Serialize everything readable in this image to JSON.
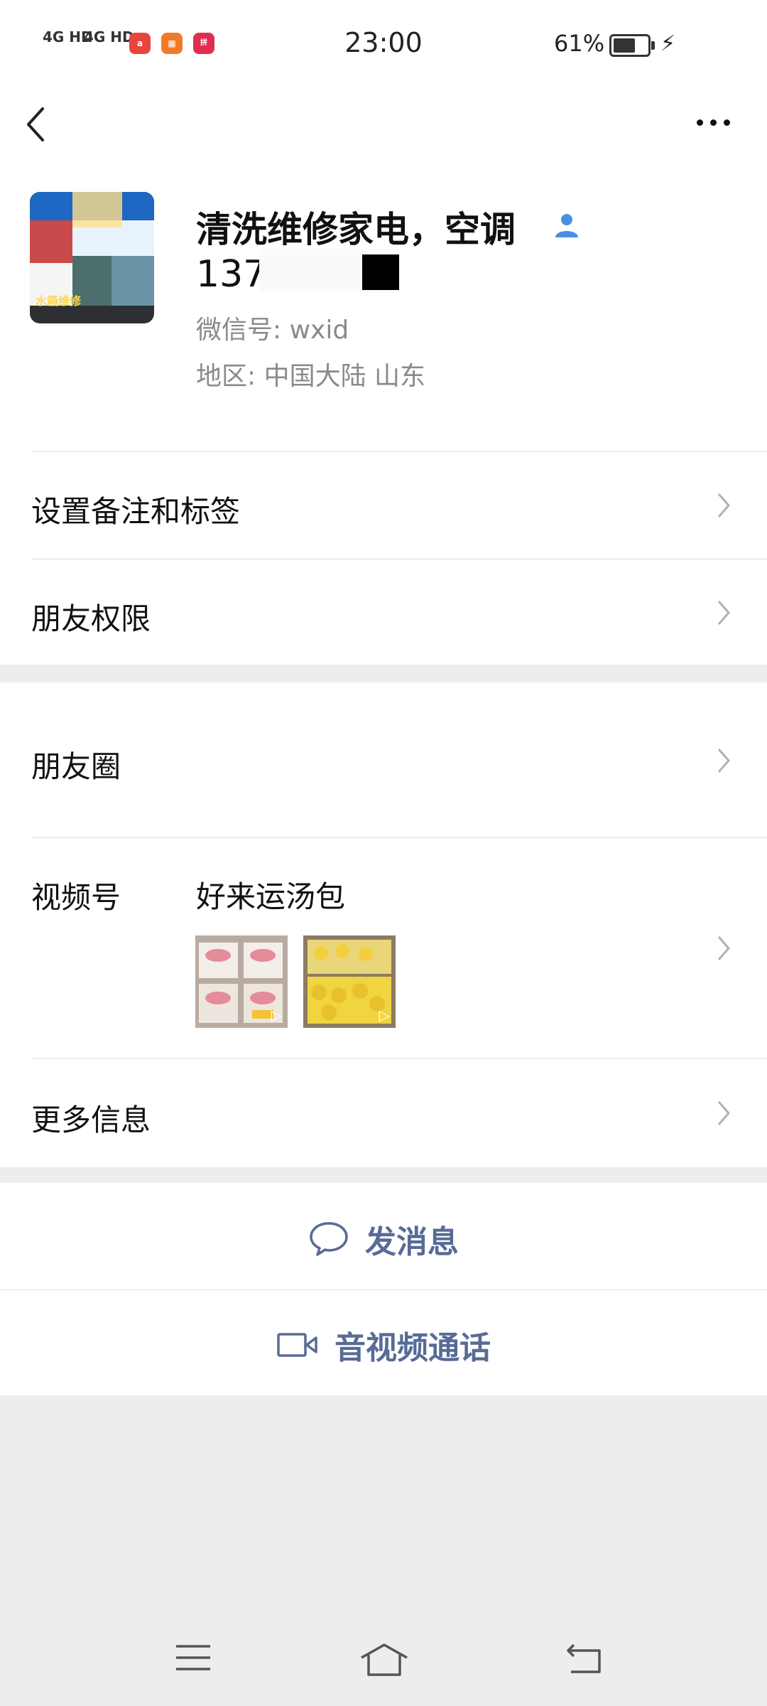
{
  "status_bar": {
    "signal1": "4G HD",
    "signal2": "4G HD",
    "time": "23:00",
    "battery_percent": "61%",
    "battery_level": 0.61,
    "app_icons": [
      "app-a-icon",
      "app-grid-icon",
      "app-pinduoduo-icon"
    ]
  },
  "nav": {
    "back_icon": "back-arrow-icon",
    "more_icon": "more-dots-icon"
  },
  "profile": {
    "name": "清洗维修家电，空调",
    "phone": "137",
    "wechat_id": "微信号:  wxid",
    "region": "地区:  中国大陆  山东",
    "avatar_text": "水箱维修"
  },
  "menu": {
    "remark_tags": "设置备注和标签",
    "friend_permissions": "朋友权限",
    "moments": "朋友圈",
    "channels": "视频号",
    "channel_name": "好来运汤包",
    "more_info": "更多信息"
  },
  "actions": {
    "send_message": "发消息",
    "av_call": "音视频通话"
  },
  "colors": {
    "link": "#576b95",
    "background": "#ededed",
    "badge_blue": "#4a90e2"
  }
}
